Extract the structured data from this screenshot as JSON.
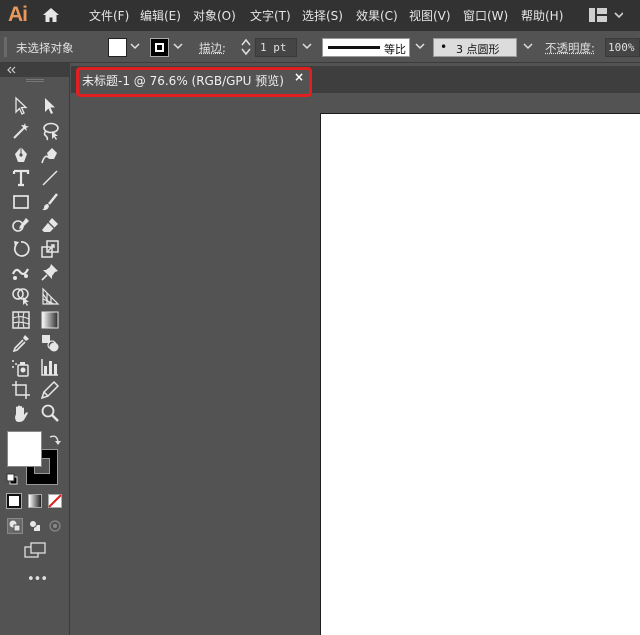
{
  "app": {
    "logo": "Ai"
  },
  "menu": [
    "文件(F)",
    "编辑(E)",
    "对象(O)",
    "文字(T)",
    "选择(S)",
    "效果(C)",
    "视图(V)",
    "窗口(W)",
    "帮助(H)"
  ],
  "control": {
    "selection": "未选择对象",
    "stroke_label": "描边:",
    "stroke_weight": "1 pt",
    "profile_label": "等比",
    "brush": "3 点圆形",
    "opacity_label": "不透明度:",
    "opacity_value": "100%"
  },
  "document": {
    "tab_title": "未标题-1 @ 76.6% (RGB/GPU 预览)",
    "close": "×"
  },
  "toolbar": {
    "more": "•••"
  },
  "colors": {
    "highlight": "#e02020",
    "logo": "#e8975d",
    "menubar": "#323232",
    "panel": "#535353"
  },
  "icons": [
    "home-icon",
    "workspace-switcher-icon",
    "selection-tool-icon",
    "direct-selection-tool-icon",
    "magic-wand-tool-icon",
    "lasso-tool-icon",
    "pen-tool-icon",
    "curvature-tool-icon",
    "type-tool-icon",
    "line-segment-tool-icon",
    "rectangle-tool-icon",
    "paintbrush-tool-icon",
    "shaper-tool-icon",
    "eraser-tool-icon",
    "rotate-tool-icon",
    "scale-tool-icon",
    "puppet-warp-tool-icon",
    "pin-tool-icon",
    "shape-builder-tool-icon",
    "perspective-grid-tool-icon",
    "mesh-tool-icon",
    "gradient-tool-icon",
    "eyedropper-tool-icon",
    "blend-tool-icon",
    "symbol-sprayer-tool-icon",
    "column-graph-tool-icon",
    "artboard-tool-icon",
    "slice-tool-icon",
    "hand-tool-icon",
    "zoom-tool-icon",
    "swap-colors-icon",
    "default-colors-icon",
    "color-mode-icon",
    "gradient-mode-icon",
    "none-mode-icon",
    "draw-normal-icon",
    "draw-behind-icon",
    "draw-inside-icon",
    "screen-mode-icon",
    "more-tools-icon"
  ]
}
